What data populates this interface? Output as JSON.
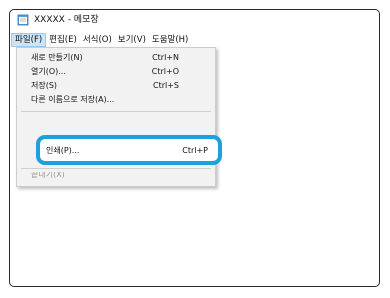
{
  "window": {
    "title": "XXXXX - 메모장"
  },
  "menubar": {
    "items": [
      {
        "label": "파일(F)"
      },
      {
        "label": "편집(E)"
      },
      {
        "label": "서식(O)"
      },
      {
        "label": "보기(V)"
      },
      {
        "label": "도움말(H)"
      }
    ]
  },
  "file_menu": {
    "items": [
      {
        "label": "새로 만들기(N)",
        "shortcut": "Ctrl+N"
      },
      {
        "label": "열기(O)...",
        "shortcut": "Ctrl+O"
      },
      {
        "label": "저장(S)",
        "shortcut": "Ctrl+S"
      },
      {
        "label": "다른 이름으로 저장(A)...",
        "shortcut": ""
      },
      {
        "label": "인쇄(P)...",
        "shortcut": "Ctrl+P"
      },
      {
        "label": "끝내기(X)",
        "shortcut": ""
      }
    ]
  },
  "colors": {
    "highlight_border": "#1ea0dc",
    "menu_active_bg": "#cce4f7",
    "dropdown_bg": "#f2f2f2"
  },
  "icons": {
    "app": "notepad-icon"
  }
}
